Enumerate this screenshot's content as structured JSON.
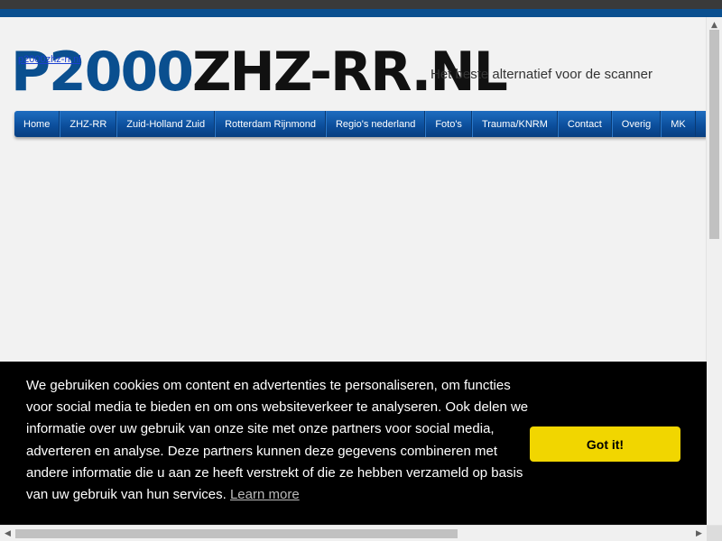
{
  "header": {
    "logo_part1": "P2000",
    "logo_part2": "ZHZ-RR.NL",
    "logo_alt_link": "p2000zhz-rr.nl",
    "tagline": "Het beste alternatief voor de scanner"
  },
  "nav": {
    "items": [
      "Home",
      "ZHZ-RR",
      "Zuid-Holland Zuid",
      "Rotterdam Rijnmond",
      "Regio's nederland",
      "Foto's",
      "Trauma/KNRM",
      "Contact",
      "Overig",
      "MK"
    ]
  },
  "cookie_banner": {
    "text": "We gebruiken cookies om content en advertenties te personaliseren, om functies voor social media te bieden en om ons websiteverkeer te analyseren. Ook delen we informatie over uw gebruik van onze site met onze partners voor social media, adverteren en analyse. Deze partners kunnen deze gegevens combineren met andere informatie die u aan ze heeft verstrekt of die ze hebben verzameld op basis van uw gebruik van hun services.",
    "learn_more": "Learn more",
    "button_label": "Got it!"
  },
  "colors": {
    "brand_blue": "#0a4f8f",
    "cookie_bg": "#000000",
    "button_yellow": "#f1d600"
  },
  "icons": {
    "scroll_up": "▲",
    "scroll_left": "◀",
    "scroll_right": "▶"
  }
}
